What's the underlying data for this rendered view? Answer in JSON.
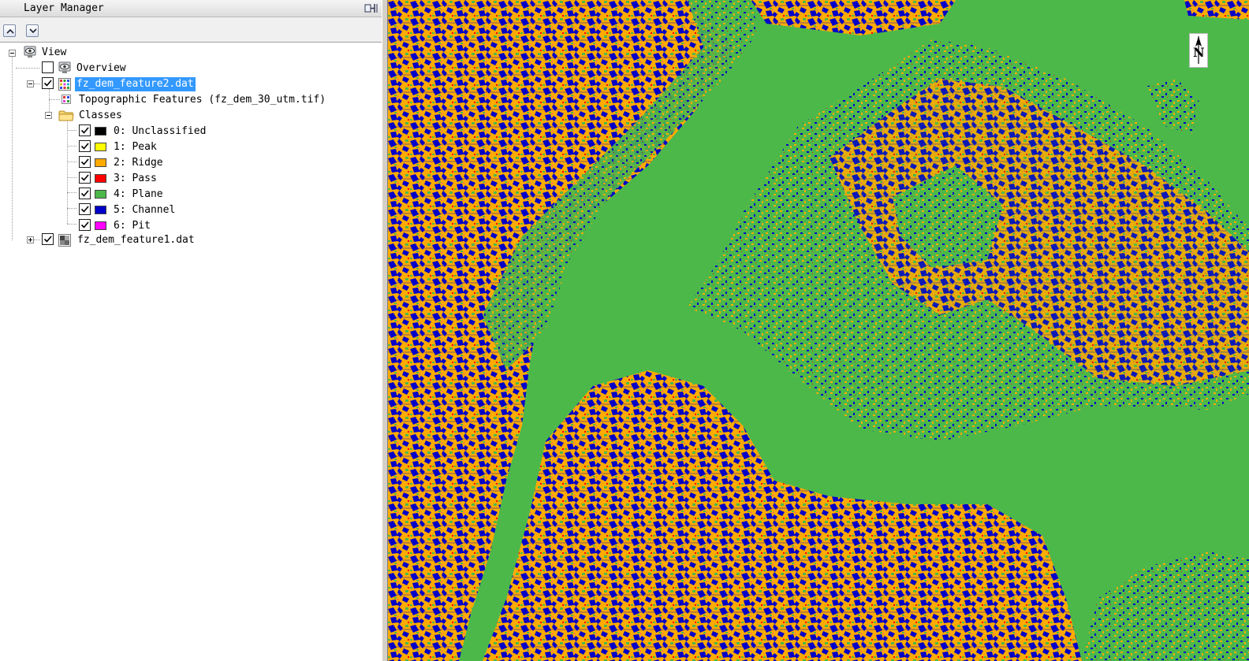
{
  "panel": {
    "title": "Layer Manager",
    "toolbar": {
      "up_icon": "move-up-icon",
      "down_icon": "move-down-icon"
    },
    "pin_icon": "pin-icon"
  },
  "tree": {
    "root": {
      "label": "View",
      "icon": "view-eye-icon",
      "expanded": true
    },
    "overview": {
      "label": "Overview",
      "checked": false,
      "icon": "view-eye-icon"
    },
    "layer2": {
      "label": "fz_dem_feature2.dat",
      "checked": true,
      "selected": true,
      "expanded": true,
      "icon": "classification-raster-icon",
      "band": {
        "label": "Topographic Features (fz_dem_30_utm.tif)",
        "icon": "band-icon"
      },
      "classes_folder": {
        "label": "Classes",
        "icon": "folder-icon",
        "expanded": true
      },
      "classes": [
        {
          "label": "0: Unclassified",
          "color": "#000000",
          "checked": true
        },
        {
          "label": "1: Peak",
          "color": "#ffff00",
          "checked": true
        },
        {
          "label": "2: Ridge",
          "color": "#ffaa00",
          "checked": true
        },
        {
          "label": "3: Pass",
          "color": "#ff0000",
          "checked": true
        },
        {
          "label": "4: Plane",
          "color": "#4cb84a",
          "checked": true
        },
        {
          "label": "5: Channel",
          "color": "#0000c8",
          "checked": true
        },
        {
          "label": "6: Pit",
          "color": "#ff00ff",
          "checked": true
        }
      ]
    },
    "layer1": {
      "label": "fz_dem_feature1.dat",
      "checked": true,
      "expanded": false,
      "icon": "grayscale-raster-icon"
    }
  },
  "map": {
    "north_label": "N",
    "north_icon": "north-arrow-icon",
    "colors": {
      "plane": "#4cb84a",
      "ridge": "#ffaa00",
      "channel": "#0000c8",
      "pass": "#ff0000",
      "pit": "#ff00ff"
    }
  }
}
